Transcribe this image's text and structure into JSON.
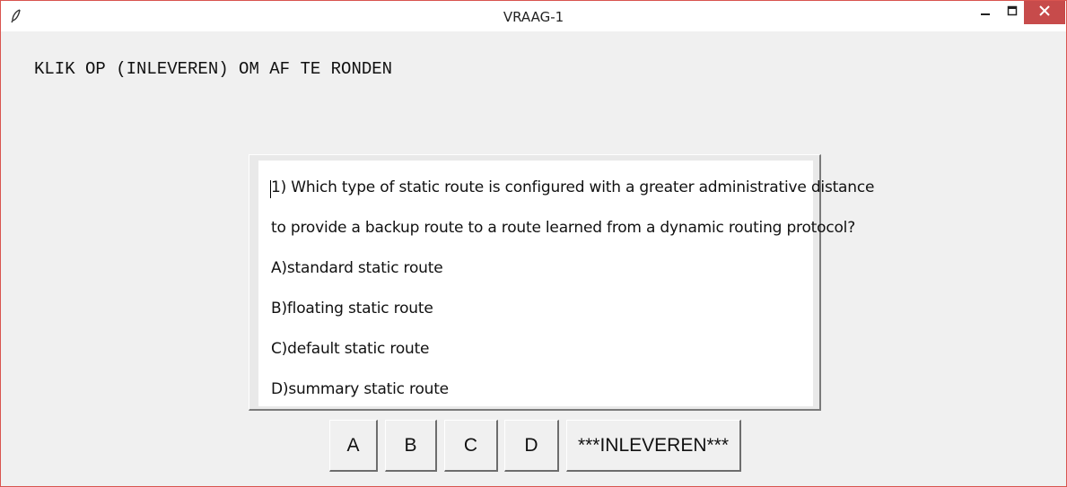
{
  "window": {
    "title": "VRAAG-1",
    "icon": "feather-icon",
    "controls": [
      "minimize-icon",
      "maximize-icon",
      "close-icon"
    ],
    "close_color": "#c74b4b",
    "border_color": "#d9544f"
  },
  "instruction": "KLIK OP (INLEVEREN) OM AF TE RONDEN",
  "question": {
    "line1": "1) Which type of static route is configured with a greater administrative distance",
    "line2": "to provide a backup route to a route learned from a dynamic routing protocol?",
    "options": [
      "A)standard static route",
      "B)floating static route",
      "C)default static route",
      "D)summary static route"
    ]
  },
  "buttons": {
    "a": "A",
    "b": "B",
    "c": "C",
    "d": "D",
    "submit": "***INLEVEREN***"
  }
}
